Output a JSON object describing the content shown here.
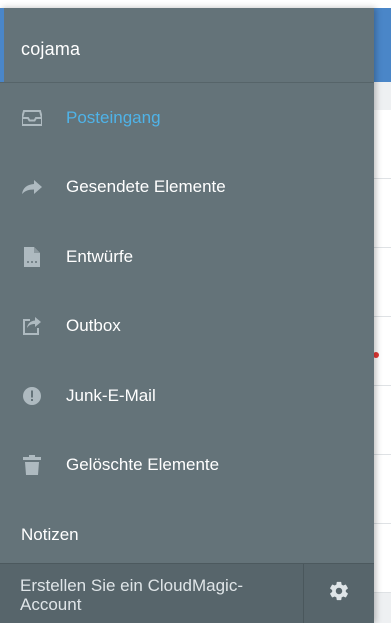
{
  "account": {
    "name": "cojama"
  },
  "nav": {
    "items": [
      {
        "label": "Posteingang",
        "icon": "inbox-icon",
        "active": true
      },
      {
        "label": "Gesendete Elemente",
        "icon": "send-icon",
        "active": false
      },
      {
        "label": "Entwürfe",
        "icon": "draft-document-icon",
        "active": false
      },
      {
        "label": "Outbox",
        "icon": "outbox-icon",
        "active": false
      },
      {
        "label": "Junk-E-Mail",
        "icon": "exclamation-circle-icon",
        "active": false
      },
      {
        "label": "Gelöschte Elemente",
        "icon": "trash-icon",
        "active": false
      },
      {
        "label": "Notizen",
        "icon": "",
        "active": false
      }
    ]
  },
  "footer": {
    "create_account_text": "Erstellen Sie ein CloudMagic-Account",
    "settings_icon": "gear-icon"
  },
  "colors": {
    "drawer_bg": "#647379",
    "active_text": "#4fb3e8",
    "footer_bg": "#57656b",
    "topbar": "#4a86c8"
  }
}
